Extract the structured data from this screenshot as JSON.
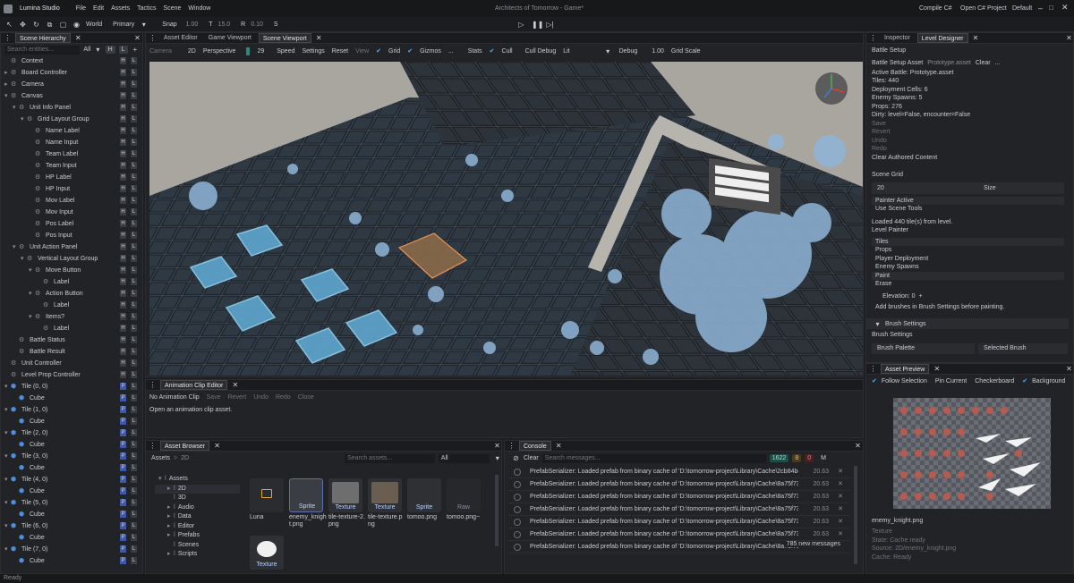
{
  "app": {
    "name": "Lumina Studio",
    "window_title": "Architects of Tomorrow - Game*"
  },
  "menu": [
    "File",
    "Edit",
    "Assets",
    "Tactics",
    "Scene",
    "Window"
  ],
  "topright": [
    "Compile C#",
    "Open C# Project",
    "Default"
  ],
  "toolbar": {
    "world": "World",
    "primary": "Primary",
    "snap": "Snap",
    "snap_val": "1.00",
    "t_label": "T",
    "t_val": "15.0",
    "r_label": "R",
    "r_val": "0.10",
    "s_label": "S"
  },
  "hierarchy": {
    "tab": "Scene Hierarchy",
    "search_placeholder": "Search entities...",
    "filter": "All",
    "items": [
      {
        "label": "Context",
        "indent": 0,
        "flags": [
          "H",
          "L"
        ],
        "icon": "entity",
        "arrow": ""
      },
      {
        "label": "Board Controller",
        "indent": 0,
        "flags": [
          "H",
          "L"
        ],
        "icon": "entity",
        "arrow": "▸"
      },
      {
        "label": "Camera",
        "indent": 0,
        "flags": [
          "H",
          "L"
        ],
        "icon": "entity",
        "arrow": "▸"
      },
      {
        "label": "Canvas",
        "indent": 0,
        "flags": [
          "H",
          "L"
        ],
        "icon": "entity",
        "arrow": "▾"
      },
      {
        "label": "Unit Info Panel",
        "indent": 1,
        "flags": [
          "H",
          "L"
        ],
        "icon": "entity",
        "arrow": "▾"
      },
      {
        "label": "Grid Layout Group",
        "indent": 2,
        "flags": [
          "H",
          "L"
        ],
        "icon": "entity",
        "arrow": "▾"
      },
      {
        "label": "Name Label",
        "indent": 3,
        "flags": [
          "H",
          "L"
        ],
        "icon": "entity",
        "arrow": ""
      },
      {
        "label": "Name Input",
        "indent": 3,
        "flags": [
          "H",
          "L"
        ],
        "icon": "entity",
        "arrow": ""
      },
      {
        "label": "Team Label",
        "indent": 3,
        "flags": [
          "H",
          "L"
        ],
        "icon": "entity",
        "arrow": ""
      },
      {
        "label": "Team Input",
        "indent": 3,
        "flags": [
          "H",
          "L"
        ],
        "icon": "entity",
        "arrow": ""
      },
      {
        "label": "HP Label",
        "indent": 3,
        "flags": [
          "H",
          "L"
        ],
        "icon": "entity",
        "arrow": ""
      },
      {
        "label": "HP Input",
        "indent": 3,
        "flags": [
          "H",
          "L"
        ],
        "icon": "entity",
        "arrow": ""
      },
      {
        "label": "Mov Label",
        "indent": 3,
        "flags": [
          "H",
          "L"
        ],
        "icon": "entity",
        "arrow": ""
      },
      {
        "label": "Mov Input",
        "indent": 3,
        "flags": [
          "H",
          "L"
        ],
        "icon": "entity",
        "arrow": ""
      },
      {
        "label": "Pos Label",
        "indent": 3,
        "flags": [
          "H",
          "L"
        ],
        "icon": "entity",
        "arrow": ""
      },
      {
        "label": "Pos Input",
        "indent": 3,
        "flags": [
          "H",
          "L"
        ],
        "icon": "entity",
        "arrow": ""
      },
      {
        "label": "Unit Action Panel",
        "indent": 1,
        "flags": [
          "H",
          "L"
        ],
        "icon": "entity",
        "arrow": "▾"
      },
      {
        "label": "Vertical Layout Group",
        "indent": 2,
        "flags": [
          "H",
          "L"
        ],
        "icon": "entity",
        "arrow": "▾"
      },
      {
        "label": "Move Button",
        "indent": 3,
        "flags": [
          "H",
          "L"
        ],
        "icon": "entity",
        "arrow": "▾"
      },
      {
        "label": "Label",
        "indent": 4,
        "flags": [
          "H",
          "L"
        ],
        "icon": "entity",
        "arrow": ""
      },
      {
        "label": "Action Button",
        "indent": 3,
        "flags": [
          "H",
          "L"
        ],
        "icon": "entity",
        "arrow": "▾"
      },
      {
        "label": "Label",
        "indent": 4,
        "flags": [
          "H",
          "L"
        ],
        "icon": "entity",
        "arrow": ""
      },
      {
        "label": "Items?",
        "indent": 3,
        "flags": [
          "H",
          "L"
        ],
        "icon": "entity",
        "arrow": "▾"
      },
      {
        "label": "Label",
        "indent": 4,
        "flags": [
          "H",
          "L"
        ],
        "icon": "entity",
        "arrow": ""
      },
      {
        "label": "Battle Status",
        "indent": 1,
        "flags": [
          "H",
          "L"
        ],
        "icon": "entity",
        "arrow": ""
      },
      {
        "label": "Battle Result",
        "indent": 1,
        "flags": [
          "H",
          "L"
        ],
        "icon": "entity",
        "arrow": ""
      },
      {
        "label": "Unit Controller",
        "indent": 0,
        "flags": [
          "H",
          "L"
        ],
        "icon": "entity",
        "arrow": ""
      },
      {
        "label": "Level Prop Controller",
        "indent": 0,
        "flags": [
          "H",
          "L"
        ],
        "icon": "entity",
        "arrow": ""
      },
      {
        "label": "Tile (0, 0)",
        "indent": 0,
        "flags": [
          "P",
          "L"
        ],
        "icon": "cube",
        "arrow": "▾"
      },
      {
        "label": "Cube",
        "indent": 1,
        "flags": [
          "P",
          "L"
        ],
        "icon": "cube",
        "arrow": ""
      },
      {
        "label": "Tile (1, 0)",
        "indent": 0,
        "flags": [
          "P",
          "L"
        ],
        "icon": "cube",
        "arrow": "▾"
      },
      {
        "label": "Cube",
        "indent": 1,
        "flags": [
          "P",
          "L"
        ],
        "icon": "cube",
        "arrow": ""
      },
      {
        "label": "Tile (2, 0)",
        "indent": 0,
        "flags": [
          "P",
          "L"
        ],
        "icon": "cube",
        "arrow": "▾"
      },
      {
        "label": "Cube",
        "indent": 1,
        "flags": [
          "P",
          "L"
        ],
        "icon": "cube",
        "arrow": ""
      },
      {
        "label": "Tile (3, 0)",
        "indent": 0,
        "flags": [
          "P",
          "L"
        ],
        "icon": "cube",
        "arrow": "▾"
      },
      {
        "label": "Cube",
        "indent": 1,
        "flags": [
          "P",
          "L"
        ],
        "icon": "cube",
        "arrow": ""
      },
      {
        "label": "Tile (4, 0)",
        "indent": 0,
        "flags": [
          "P",
          "L"
        ],
        "icon": "cube",
        "arrow": "▾"
      },
      {
        "label": "Cube",
        "indent": 1,
        "flags": [
          "P",
          "L"
        ],
        "icon": "cube",
        "arrow": ""
      },
      {
        "label": "Tile (5, 0)",
        "indent": 0,
        "flags": [
          "P",
          "L"
        ],
        "icon": "cube",
        "arrow": "▾"
      },
      {
        "label": "Cube",
        "indent": 1,
        "flags": [
          "P",
          "L"
        ],
        "icon": "cube",
        "arrow": ""
      },
      {
        "label": "Tile (6, 0)",
        "indent": 0,
        "flags": [
          "P",
          "L"
        ],
        "icon": "cube",
        "arrow": "▾"
      },
      {
        "label": "Cube",
        "indent": 1,
        "flags": [
          "P",
          "L"
        ],
        "icon": "cube",
        "arrow": ""
      },
      {
        "label": "Tile (7, 0)",
        "indent": 0,
        "flags": [
          "P",
          "L"
        ],
        "icon": "cube",
        "arrow": "▾"
      },
      {
        "label": "Cube",
        "indent": 1,
        "flags": [
          "P",
          "L"
        ],
        "icon": "cube",
        "arrow": ""
      }
    ]
  },
  "center_tabs": [
    "Asset Editor",
    "Game Viewport",
    "Scene Viewport"
  ],
  "viewport_bar": {
    "camera": "Camera",
    "mode": "2D",
    "perspective": "Perspective",
    "fov": "29",
    "speed": "Speed",
    "settings": "Settings",
    "reset": "Reset",
    "view": "View",
    "grid": "Grid",
    "gizmos": "Gizmos",
    "more": "...",
    "stats": "Stats",
    "cull": "Cull",
    "cull_debug": "Cull Debug",
    "lit": "Lit",
    "debug": "Debug",
    "debug_val": "1.00",
    "grid_scale": "Grid Scale"
  },
  "anim": {
    "tab": "Animation Clip Editor",
    "no_clip": "No Animation Clip",
    "actions": [
      "Save",
      "Revert",
      "Undo",
      "Redo",
      "Close"
    ],
    "hint": "Open an animation clip asset."
  },
  "assets": {
    "tab": "Asset Browser",
    "breadcrumb": [
      "Assets",
      "2D"
    ],
    "search_placeholder": "Search assets...",
    "filter": "All",
    "tree": [
      {
        "label": "Assets",
        "indent": 0,
        "arrow": "▾"
      },
      {
        "label": "2D",
        "indent": 1,
        "arrow": "▸"
      },
      {
        "label": "3D",
        "indent": 1,
        "arrow": ""
      },
      {
        "label": "Audio",
        "indent": 1,
        "arrow": "▸"
      },
      {
        "label": "Data",
        "indent": 1,
        "arrow": "▸"
      },
      {
        "label": "Editor",
        "indent": 1,
        "arrow": "▸"
      },
      {
        "label": "Prefabs",
        "indent": 1,
        "arrow": "▸"
      },
      {
        "label": "Scenes",
        "indent": 1,
        "arrow": ""
      },
      {
        "label": "Scripts",
        "indent": 1,
        "arrow": "▸"
      }
    ],
    "tiles": [
      {
        "name": "Luna",
        "badge": "",
        "type": "folder"
      },
      {
        "name": "enemy_knight.png",
        "badge": "Sprite",
        "type": "sprite"
      },
      {
        "name": "tile-texture-2.png",
        "badge": "Texture",
        "type": "tex1"
      },
      {
        "name": "tile-texture.png",
        "badge": "Texture",
        "type": "tex2"
      },
      {
        "name": "tomoo.png",
        "badge": "Sprite",
        "type": "sprite2"
      },
      {
        "name": "tomoo.png~",
        "badge": "Raw",
        "type": "raw"
      },
      {
        "name": "",
        "badge": "Texture",
        "type": "splash"
      }
    ]
  },
  "console": {
    "tab": "Console",
    "clear": "Clear",
    "search_placeholder": "Search messages...",
    "counts": {
      "info": "1622",
      "warn": "8",
      "error": "0"
    },
    "m": "M",
    "rows": [
      {
        "msg": "PrefabSerializer: Loaded prefab from binary cache of 'D:\\tomorrow-project\\Library\\Cache\\2cb84bc0016d6725.pref",
        "ts": "20.63"
      },
      {
        "msg": "PrefabSerializer: Loaded prefab from binary cache of 'D:\\tomorrow-project\\Library\\Cache\\8a75f73408e7531d.pref",
        "ts": "20.63"
      },
      {
        "msg": "PrefabSerializer: Loaded prefab from binary cache of 'D:\\tomorrow-project\\Library\\Cache\\8a75f73408e7531d.pref",
        "ts": "20.63"
      },
      {
        "msg": "PrefabSerializer: Loaded prefab from binary cache of 'D:\\tomorrow-project\\Library\\Cache\\8a75f73408e7531d.pref",
        "ts": "20.63"
      },
      {
        "msg": "PrefabSerializer: Loaded prefab from binary cache of 'D:\\tomorrow-project\\Library\\Cache\\8a75f73408e7531d.pref",
        "ts": "20.63"
      },
      {
        "msg": "PrefabSerializer: Loaded prefab from binary cache of 'D:\\tomorrow-project\\Library\\Cache\\8a75f73408e7531d.pref",
        "ts": "20.63"
      },
      {
        "msg": "PrefabSerializer: Loaded prefab from binary cache of 'D:\\tomorrow-project\\Library\\Cache\\8a75f73408",
        "ts": ""
      }
    ],
    "new_messages": "785 new messages"
  },
  "right_tabs": [
    "Inspector",
    "Level Designer"
  ],
  "level": {
    "battle_setup": "Battle Setup",
    "asset_label": "Battle Setup Asset",
    "asset_value": "Prototype.asset",
    "asset_clear": "Clear",
    "asset_more": "...",
    "info": [
      "Active Battle: Prototype.asset",
      "Tiles: 440",
      "Deployment Cells: 6",
      "Enemy Spawns: 5",
      "Props: 276",
      "Dirty: level=False, encounter=False"
    ],
    "actions": [
      "Save",
      "Revert",
      "Undo",
      "Redo",
      "Clear Authored Content"
    ],
    "scene_grid": "Scene Grid",
    "grid_size_val": "20",
    "grid_size_label": "Size",
    "painter_active": "Painter Active",
    "use_scene_tools": "Use Scene Tools",
    "loaded": "Loaded 440 tile(s) from level.",
    "level_painter": "Level Painter",
    "painter_modes": [
      "Tiles",
      "Props",
      "Player Deployment",
      "Enemy Spawns",
      "Paint",
      "Erase"
    ],
    "elevation": "Elevation: 0",
    "elevation_plus": "+",
    "hint": "Add brushes in Brush Settings before painting.",
    "brush_settings_hdr": "Brush Settings",
    "brush_settings": "Brush Settings",
    "brush_palette": "Brush Palette",
    "selected_brush": "Selected Brush"
  },
  "preview": {
    "tab": "Asset Preview",
    "options": [
      "Follow Selection",
      "Pin Current",
      "Checkerboard",
      "Background"
    ],
    "file": "enemy_knight.png",
    "meta": [
      "Texture",
      "State: Cache ready",
      "Source: 2D/enemy_knight.png",
      "Cache: Ready"
    ]
  },
  "scene_ui": {
    "menu_items": [
      "Move",
      "Action",
      "Items?"
    ]
  },
  "status": "Ready",
  "colors": {
    "accent": "#2b8a7e",
    "selection": "#ff6a3c",
    "tile_blue": "#59aadd"
  }
}
